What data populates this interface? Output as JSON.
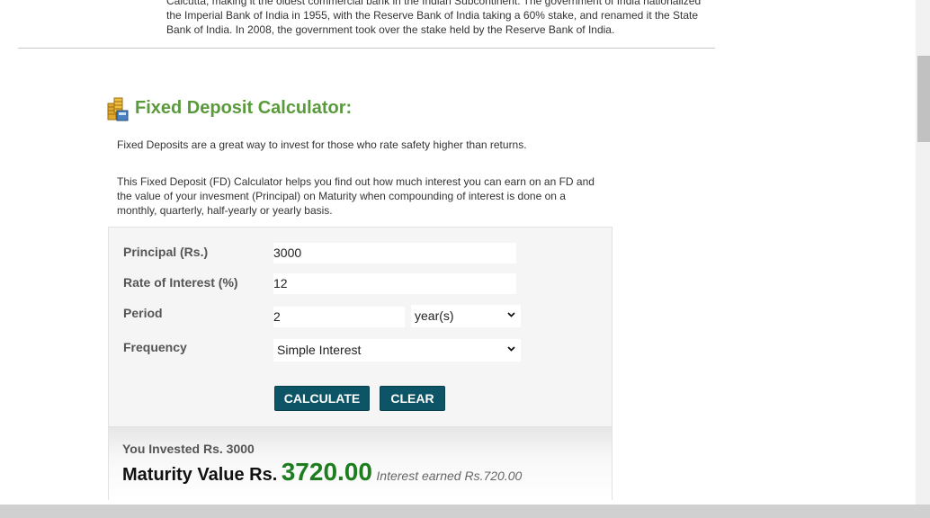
{
  "intro": {
    "line1": "Calcutta, making it the oldest commercial bank in the Indian Subcontinent. The government of India nationalized",
    "line2": "the Imperial Bank of India in 1955, with the Reserve Bank of India taking a 60% stake, and renamed it the State",
    "line3": "Bank of India. In 2008, the government took over the stake held by the Reserve Bank of India."
  },
  "calculator": {
    "title": "Fixed Deposit Calculator:",
    "description1": "Fixed Deposits are a great way to invest for those who rate safety higher than returns.",
    "description2": "This Fixed Deposit (FD) Calculator helps you find out how much interest you can earn on an FD and the value of your invesment (Principal) on Maturity when compounding of interest is done on a monthly, quarterly, half-yearly or yearly basis.",
    "fields": {
      "principal": {
        "label": "Principal (Rs.)",
        "value": "3000"
      },
      "rate": {
        "label": "Rate of Interest (%)",
        "value": "12"
      },
      "period": {
        "label": "Period",
        "value": "2",
        "unit": "year(s)"
      },
      "frequency": {
        "label": "Frequency",
        "value": "Simple Interest"
      }
    },
    "buttons": {
      "calculate": "CALCULATE",
      "clear": "CLEAR"
    },
    "result": {
      "invested": "You Invested Rs. 3000",
      "maturity_label": "Maturity Value Rs.",
      "maturity_value": "3720.00",
      "interest_earned": "Interest earned Rs.720.00"
    }
  },
  "colors": {
    "title_green": "#5a9a3c",
    "button_teal": "#0d5566",
    "maturity_green": "#1e7d1e"
  }
}
